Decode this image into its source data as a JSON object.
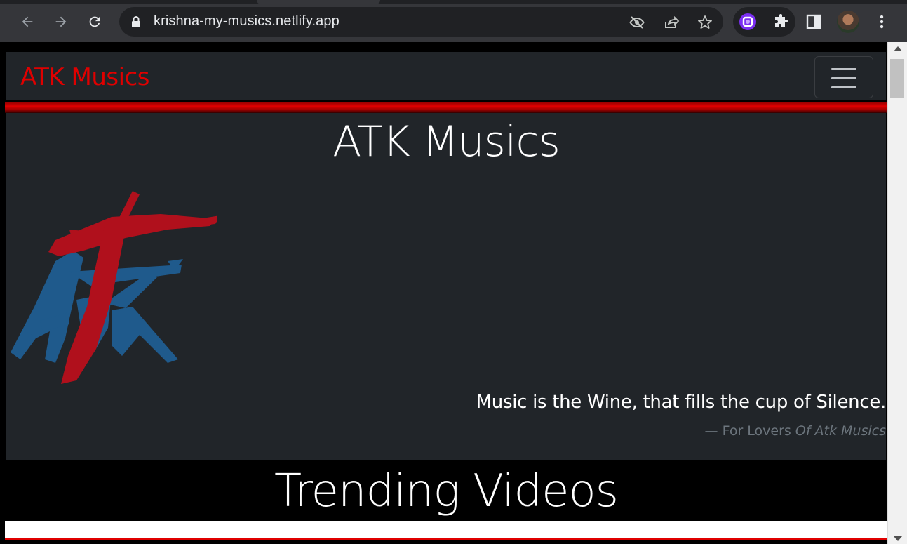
{
  "browser": {
    "url": "krishna-my-musics.netlify.app",
    "icons": {
      "back": "arrow-left-icon",
      "forward": "arrow-right-icon",
      "reload": "reload-icon",
      "lock": "lock-icon",
      "eye_off": "eye-off-icon",
      "share": "share-icon",
      "bookmark": "star-icon",
      "extension": "puzzle-icon",
      "side_panel": "side-panel-icon",
      "menu": "kebab-menu-icon"
    }
  },
  "navbar": {
    "brand": "ATK Musics",
    "brand_color": "#e00000",
    "toggler_icon": "hamburger-icon"
  },
  "hero": {
    "title": "ATK Musics",
    "logo_icon": "atk-logo-icon",
    "quote": "Music is the Wine, that fills the cup of Silence.",
    "footer_prefix": "— For Lovers ",
    "footer_cite": "Of Atk Musics"
  },
  "trending": {
    "title": "Trending Videos"
  }
}
